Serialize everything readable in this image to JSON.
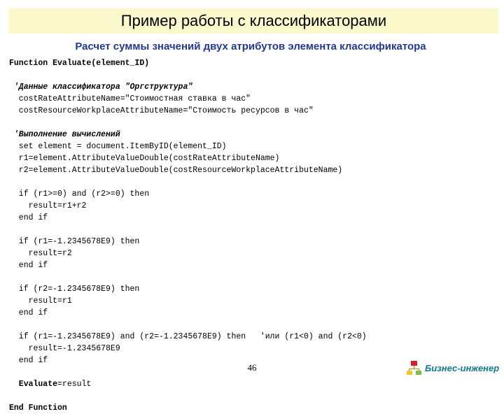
{
  "slide": {
    "title": "Пример работы с классификаторами",
    "subtitle": "Расчет суммы значений двух атрибутов элемента классификатора",
    "title_band_color": "#FBF8CC",
    "subtitle_color": "#1F3A93",
    "page_number": "46"
  },
  "code": {
    "lines": [
      {
        "text": "Function Evaluate(element_ID)",
        "style": "keyword"
      },
      {
        "text": "",
        "style": "blank"
      },
      {
        "text": " 'Данные классификатора \"Оргструктура\"",
        "style": "comment"
      },
      {
        "text": "  costRateAttributeName=\"Стоимостная ставка в час\"",
        "style": "plain"
      },
      {
        "text": "  costResourceWorkplaceAttributeName=\"Стоимость ресурсов в час\"",
        "style": "plain"
      },
      {
        "text": "",
        "style": "blank"
      },
      {
        "text": " 'Выполнение вычислений",
        "style": "comment"
      },
      {
        "text": "  set element = document.ItemByID(element_ID)",
        "style": "plain"
      },
      {
        "text": "  r1=element.AttributeValueDouble(costRateAttributeName)",
        "style": "plain"
      },
      {
        "text": "  r2=element.AttributeValueDouble(costResourceWorkplaceAttributeName)",
        "style": "plain"
      },
      {
        "text": "",
        "style": "blank"
      },
      {
        "text": "  if (r1>=0) and (r2>=0) then",
        "style": "plain"
      },
      {
        "text": "    result=r1+r2",
        "style": "plain"
      },
      {
        "text": "  end if",
        "style": "plain"
      },
      {
        "text": "",
        "style": "blank"
      },
      {
        "text": "  if (r1=-1.2345678E9) then",
        "style": "plain"
      },
      {
        "text": "    result=r2",
        "style": "plain"
      },
      {
        "text": "  end if",
        "style": "plain"
      },
      {
        "text": "",
        "style": "blank"
      },
      {
        "text": "  if (r2=-1.2345678E9) then",
        "style": "plain"
      },
      {
        "text": "    result=r1",
        "style": "plain"
      },
      {
        "text": "  end if",
        "style": "plain"
      },
      {
        "text": "",
        "style": "blank"
      },
      {
        "text": "  if (r1=-1.2345678E9) and (r2=-1.2345678E9) then   'или (r1<0) and (r2<0)",
        "style": "plain"
      },
      {
        "text": "    result=-1.2345678E9",
        "style": "plain"
      },
      {
        "text": "  end if",
        "style": "plain"
      },
      {
        "text": "",
        "style": "blank"
      },
      {
        "text": "  Evaluate=result",
        "style": "keyword-prefix",
        "bold_prefix": "  Evaluate",
        "rest": "=result"
      },
      {
        "text": "",
        "style": "blank"
      },
      {
        "text": "End Function",
        "style": "keyword"
      }
    ]
  },
  "logo": {
    "text": "Бизнес-инженер",
    "icon": "org-chart-icon",
    "text_color": "#127A8A",
    "box_top_color": "#D62024",
    "box_left_color": "#F2C829",
    "box_right_color": "#7BC043"
  }
}
